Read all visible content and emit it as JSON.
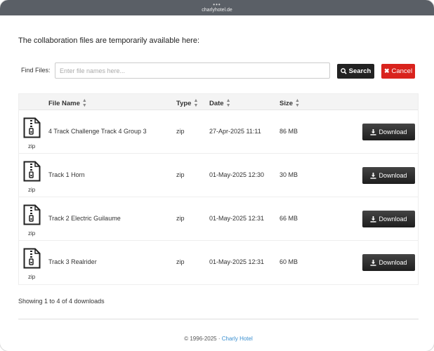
{
  "browser": {
    "url": "charlyhotel.de"
  },
  "intro": "The collaboration files are temporarily available here:",
  "search": {
    "label": "Find Files:",
    "placeholder": "Enter file names here...",
    "search_label": "Search",
    "cancel_label": "Cancel"
  },
  "table": {
    "headers": {
      "name": "File Name",
      "type": "Type",
      "date": "Date",
      "size": "Size"
    },
    "rows": [
      {
        "icon_label": "zip",
        "name": "4 Track Challenge Track 4 Group 3",
        "type": "zip",
        "date": "27-Apr-2025 11:11",
        "size": "86 MB",
        "action": "Download"
      },
      {
        "icon_label": "zip",
        "name": "Track 1 Horn",
        "type": "zip",
        "date": "01-May-2025 12:30",
        "size": "30 MB",
        "action": "Download"
      },
      {
        "icon_label": "zip",
        "name": "Track 2 Electric Guilaume",
        "type": "zip",
        "date": "01-May-2025 12:31",
        "size": "66 MB",
        "action": "Download"
      },
      {
        "icon_label": "zip",
        "name": "Track 3 Realrider",
        "type": "zip",
        "date": "01-May-2025 12:31",
        "size": "60 MB",
        "action": "Download"
      }
    ]
  },
  "summary": "Showing 1 to 4 of 4 downloads",
  "footer": {
    "copyright": "© 1996-2025 ·",
    "link": "Charly Hotel"
  },
  "colors": {
    "cancel": "#d9231d",
    "primary_button": "#222222",
    "link": "#3a8fd0"
  }
}
